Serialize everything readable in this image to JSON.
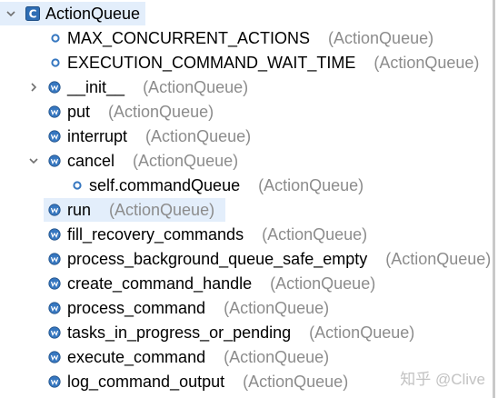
{
  "tree": {
    "root": {
      "label": "ActionQueue",
      "icon": "class-icon"
    },
    "items": [
      {
        "label": "MAX_CONCURRENT_ACTIONS",
        "owner": "(ActionQueue)",
        "icon": "field-icon",
        "depth": 1,
        "twisty": "none"
      },
      {
        "label": "EXECUTION_COMMAND_WAIT_TIME",
        "owner": "(ActionQueue)",
        "icon": "field-icon",
        "depth": 1,
        "twisty": "none"
      },
      {
        "label": "__init__",
        "owner": "(ActionQueue)",
        "icon": "method-icon",
        "depth": 1,
        "twisty": "collapsed"
      },
      {
        "label": "put",
        "owner": "(ActionQueue)",
        "icon": "method-icon",
        "depth": 1,
        "twisty": "none"
      },
      {
        "label": "interrupt",
        "owner": "(ActionQueue)",
        "icon": "method-icon",
        "depth": 1,
        "twisty": "none"
      },
      {
        "label": "cancel",
        "owner": "(ActionQueue)",
        "icon": "method-icon",
        "depth": 1,
        "twisty": "expanded"
      },
      {
        "label": "self.commandQueue",
        "owner": "(ActionQueue)",
        "icon": "field-icon",
        "depth": 2,
        "twisty": "none"
      },
      {
        "label": "run",
        "owner": "(ActionQueue)",
        "icon": "method-icon",
        "depth": 1,
        "twisty": "none",
        "selected": true
      },
      {
        "label": "fill_recovery_commands",
        "owner": "(ActionQueue)",
        "icon": "method-icon",
        "depth": 1,
        "twisty": "none"
      },
      {
        "label": "process_background_queue_safe_empty",
        "owner": "(ActionQueue)",
        "icon": "method-icon",
        "depth": 1,
        "twisty": "none"
      },
      {
        "label": "create_command_handle",
        "owner": "(ActionQueue)",
        "icon": "method-icon",
        "depth": 1,
        "twisty": "none"
      },
      {
        "label": "process_command",
        "owner": "(ActionQueue)",
        "icon": "method-icon",
        "depth": 1,
        "twisty": "none"
      },
      {
        "label": "tasks_in_progress_or_pending",
        "owner": "(ActionQueue)",
        "icon": "method-icon",
        "depth": 1,
        "twisty": "none"
      },
      {
        "label": "execute_command",
        "owner": "(ActionQueue)",
        "icon": "method-icon",
        "depth": 1,
        "twisty": "none"
      },
      {
        "label": "log_command_output",
        "owner": "(ActionQueue)",
        "icon": "method-icon",
        "depth": 1,
        "twisty": "none"
      }
    ]
  },
  "watermark": "知乎 @Clive",
  "colors": {
    "selection": "#e3eefb",
    "class_icon": "#2f6eb5",
    "method_icon": "#3677c0",
    "field_icon": "#3677c0",
    "owner_text": "#8c8c8c"
  }
}
